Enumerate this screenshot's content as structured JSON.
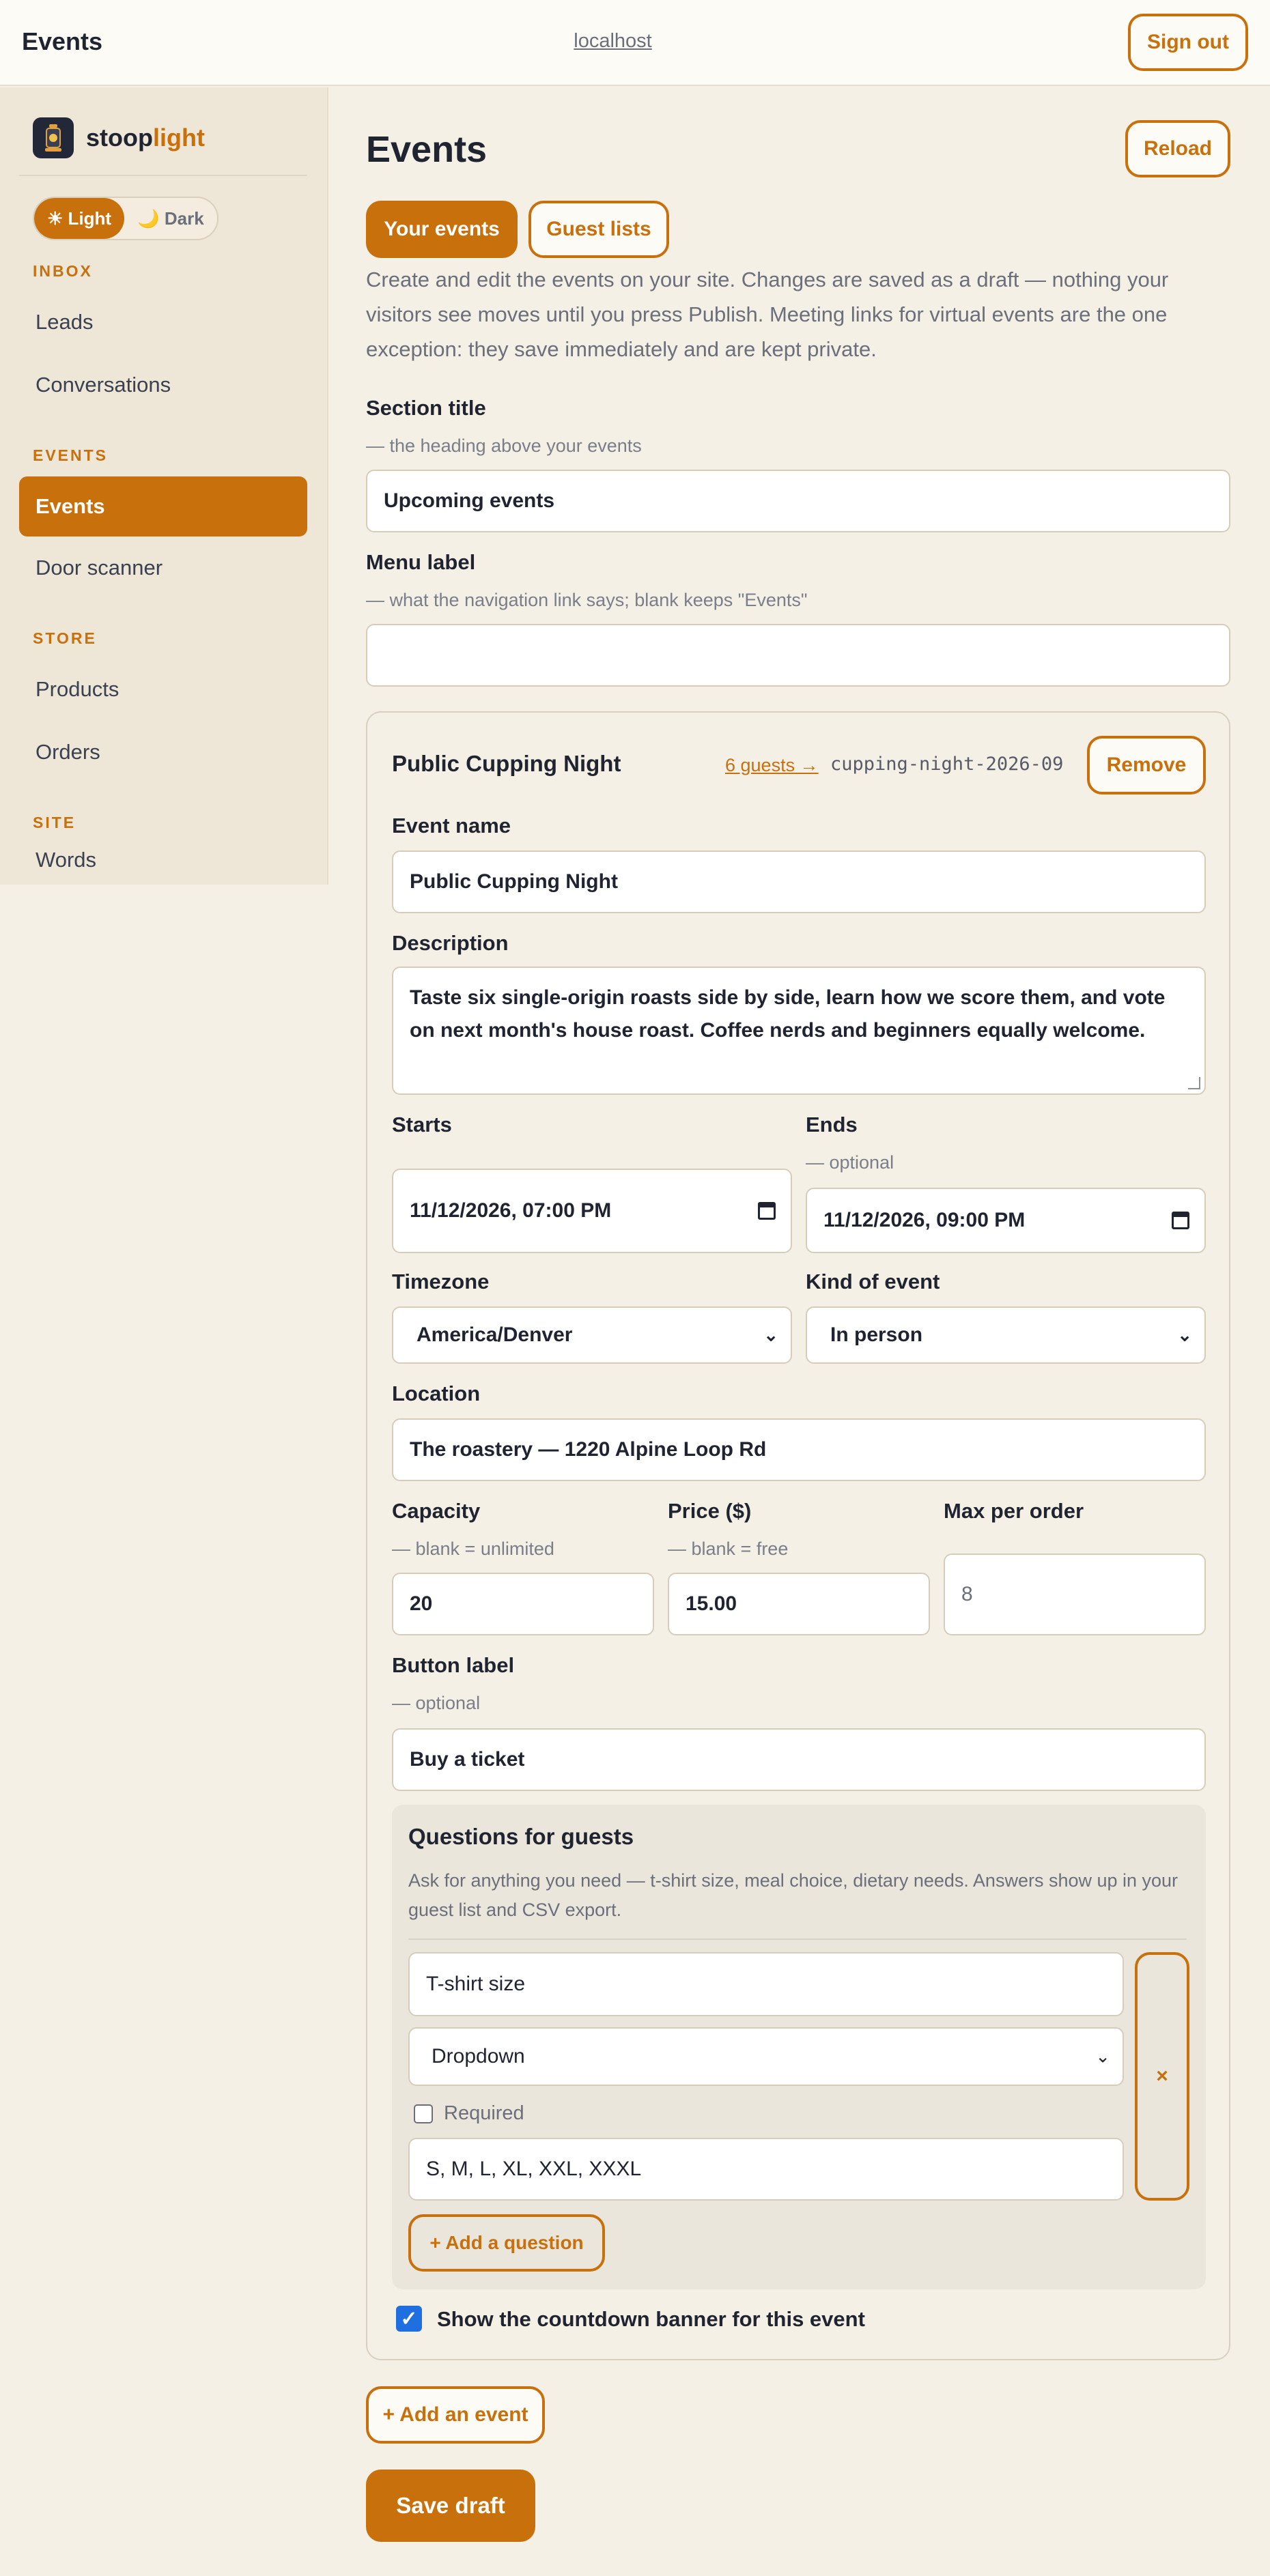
{
  "topbar": {
    "title": "Events",
    "host": "localhost",
    "signout": "Sign out"
  },
  "brand": {
    "name_a": "stoop",
    "name_b": "light"
  },
  "theme": {
    "light": "☀ Light",
    "dark": "🌙 Dark"
  },
  "sidebar": {
    "sections": [
      "INBOX",
      "EVENTS",
      "STORE",
      "SITE"
    ],
    "items": [
      "Leads",
      "Conversations",
      "Events",
      "Door scanner",
      "Products",
      "Orders",
      "Words"
    ]
  },
  "main": {
    "title": "Events",
    "reload": "Reload",
    "tabs": [
      "Your events",
      "Guest lists"
    ],
    "intro": "Create and edit the events on your site. Changes are saved as a draft — nothing your visitors see moves until you press Publish. Meeting links for virtual events are the one exception: they save immediately and are kept private.",
    "section_title": {
      "label": "Section title",
      "hint": "— the heading above your events",
      "value": "Upcoming events"
    },
    "menu_label": {
      "label": "Menu label",
      "hint": "— what the navigation link says; blank keeps \"Events\"",
      "value": ""
    }
  },
  "event": {
    "title": "Public Cupping Night",
    "guests_link": "6 guests →",
    "slug": "cupping-night-2026-09",
    "remove": "Remove",
    "name": {
      "label": "Event name",
      "value": "Public Cupping Night"
    },
    "description": {
      "label": "Description",
      "value": "Taste six single-origin roasts side by side, learn how we score them, and vote on next month's house roast. Coffee nerds and beginners equally welcome."
    },
    "starts": {
      "label": "Starts",
      "value": "11/12/2026, 07:00 PM"
    },
    "ends": {
      "label": "Ends",
      "hint": "— optional",
      "value": "11/12/2026, 09:00 PM"
    },
    "timezone": {
      "label": "Timezone",
      "value": "America/Denver"
    },
    "kind": {
      "label": "Kind of event",
      "value": "In person"
    },
    "location": {
      "label": "Location",
      "value": "The roastery — 1220 Alpine Loop Rd"
    },
    "capacity": {
      "label": "Capacity",
      "hint": "— blank = unlimited",
      "value": "20"
    },
    "price": {
      "label": "Price ($)",
      "hint": "— blank = free",
      "value": "15.00"
    },
    "max_per_order": {
      "label": "Max per order",
      "placeholder": "8"
    },
    "button_label": {
      "label": "Button label",
      "hint": "— optional",
      "value": "Buy a ticket"
    },
    "questions": {
      "title": "Questions for guests",
      "description": "Ask for anything you need — t-shirt size, meal choice, dietary needs. Answers show up in your guest list and CSV export.",
      "items": [
        {
          "question": "T-shirt size",
          "type": "Dropdown",
          "required_label": "Required",
          "options": "S, M, L, XL, XXL, XXXL",
          "remove": "×"
        }
      ],
      "add": "+ Add a question"
    },
    "countdown": "Show the countdown banner for this event"
  },
  "actions": {
    "add_event": "+ Add an event",
    "save": "Save draft"
  },
  "colors": {
    "accent": "#c8700c",
    "background": "#f5f0e6",
    "sidebar": "#eee6d6"
  }
}
